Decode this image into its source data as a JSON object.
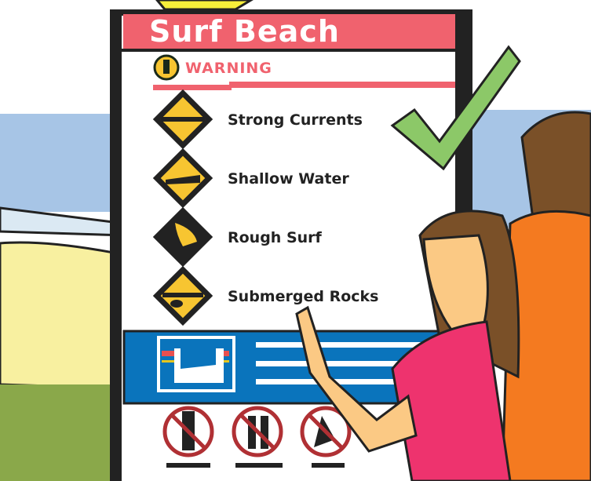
{
  "sign": {
    "title": "Surf Beach",
    "warning_label": "WARNING",
    "hazards": [
      {
        "label": "Strong Currents",
        "icon": "strong-currents-icon"
      },
      {
        "label": "Shallow Water",
        "icon": "shallow-water-icon"
      },
      {
        "label": "Rough Surf",
        "icon": "rough-surf-icon"
      },
      {
        "label": "Submerged Rocks",
        "icon": "submerged-rocks-icon"
      }
    ],
    "prohibitions": [
      "no-glass-icon",
      "no-dogs-icon",
      "no-fishing-icon"
    ]
  },
  "colors": {
    "header": "#f0626e",
    "hazard_yellow": "#f7c531",
    "info_blue": "#0a74bc",
    "check_green": "#8cc868",
    "sky": "#a7c5e6",
    "sand": "#f8f0a0",
    "grass": "#8aa84a",
    "pink_shirt": "#ee336e",
    "orange_shirt": "#f47a20",
    "hair": "#7a5028",
    "skin": "#fbc984"
  }
}
